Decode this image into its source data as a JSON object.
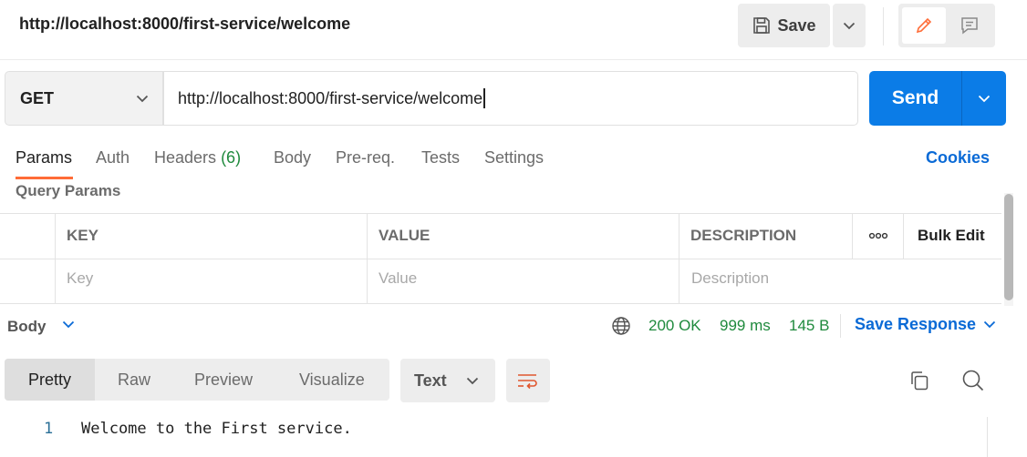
{
  "header": {
    "request_title": "http://localhost:8000/first-service/welcome",
    "save_label": "Save"
  },
  "request": {
    "method": "GET",
    "url": "http://localhost:8000/first-service/welcome",
    "send_label": "Send"
  },
  "tabs": {
    "params": "Params",
    "auth": "Auth",
    "headers": "Headers",
    "headers_count": "(6)",
    "body": "Body",
    "prereq": "Pre-req.",
    "tests": "Tests",
    "settings": "Settings",
    "active": "Params",
    "cookies": "Cookies"
  },
  "query_params": {
    "title": "Query Params",
    "columns": [
      "KEY",
      "VALUE",
      "DESCRIPTION"
    ],
    "bulk_edit": "Bulk Edit",
    "placeholders": [
      "Key",
      "Value",
      "Description"
    ]
  },
  "response": {
    "body_label": "Body",
    "status": "200 OK",
    "time": "999 ms",
    "size": "145 B",
    "save_response": "Save Response",
    "view_tabs": [
      "Pretty",
      "Raw",
      "Preview",
      "Visualize"
    ],
    "active_view": "Pretty",
    "format": "Text",
    "lines": [
      {
        "number": "1",
        "text": "Welcome to the First service."
      }
    ]
  },
  "colors": {
    "accent_orange": "#ff6c37",
    "send_blue": "#0b7ce7",
    "link_blue": "#0a6ad6",
    "status_green": "#1f8a3d"
  },
  "icons": [
    "save-icon",
    "chevron-down-icon",
    "pencil-icon",
    "comment-icon",
    "more-icon",
    "globe-icon",
    "wrap-icon",
    "copy-icon",
    "search-icon"
  ]
}
